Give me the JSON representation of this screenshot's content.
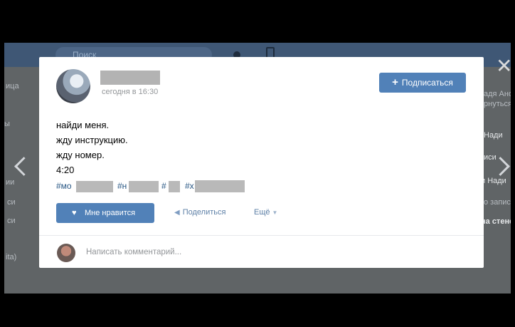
{
  "background": {
    "search_placeholder": "Поиск",
    "left_fragments": [
      "ица",
      "ы",
      "ии",
      "си",
      "си",
      "ita)"
    ],
    "right_fragments": [
      "адя Анос",
      "рнуться",
      "Нади",
      "иси",
      "и Нади",
      "о запис",
      "на стене"
    ]
  },
  "post": {
    "timestamp": "сегодня в 16:30",
    "subscribe_label": "Подписаться",
    "subscribe_icon": "plus-icon",
    "lines": [
      "найди меня.",
      "жду инструкцию.",
      "жду номер.",
      "4:20"
    ],
    "hashtags": [
      "#мо",
      "#н",
      "#",
      "#х"
    ]
  },
  "actions": {
    "like_label": "Мне нравится",
    "like_icon": "heart-icon",
    "share_label": "Поделиться",
    "share_icon": "megaphone-icon",
    "more_label": "Ещё"
  },
  "comment": {
    "placeholder": "Написать комментарий..."
  },
  "controls": {
    "close_icon": "close-icon",
    "prev_icon": "chevron-left-icon",
    "next_icon": "chevron-right-icon"
  },
  "colors": {
    "accent": "#5181b8",
    "link": "#2a5885",
    "header": "#3f5775"
  }
}
